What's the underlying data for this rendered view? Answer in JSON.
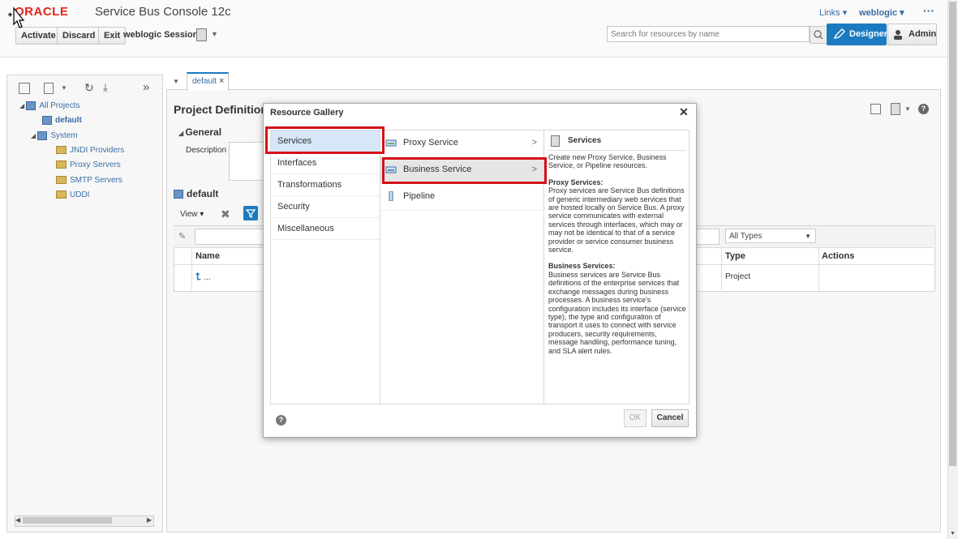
{
  "header": {
    "logo": "ORACLE",
    "product": "Service Bus Console 12c",
    "links_label": "Links",
    "user_label": "weblogic",
    "more_label": "···",
    "activate": "Activate",
    "discard": "Discard",
    "exit": "Exit",
    "session": "weblogic Session",
    "search_placeholder": "Search for resources by name",
    "designer": "Designer",
    "admin": "Admin"
  },
  "tree": {
    "all_projects": "All Projects",
    "default": "default",
    "system": "System",
    "children": [
      "JNDI Providers",
      "Proxy Servers",
      "SMTP Servers",
      "UDDI"
    ]
  },
  "main": {
    "tab": "default",
    "title": "Project Definition",
    "general": "General",
    "description_label": "Description",
    "section": "default",
    "view": "View",
    "filter_value": "All Types",
    "columns": {
      "name": "Name",
      "type": "Type",
      "actions": "Actions"
    },
    "row": {
      "name": "...",
      "type": "Project"
    }
  },
  "dialog": {
    "title": "Resource Gallery",
    "categories": [
      "Services",
      "Interfaces",
      "Transformations",
      "Security",
      "Miscellaneous"
    ],
    "services": [
      "Proxy Service",
      "Business Service",
      "Pipeline"
    ],
    "arrow": ">",
    "desc_title": "Services",
    "desc_intro": "Create new Proxy Service, Business Service, or Pipeline resources.",
    "proxy_heading": "Proxy Services:",
    "proxy_text": "Proxy services are Service Bus definitions of generic intermediary web services that are hosted locally on Service Bus. A proxy service communicates with external services through interfaces, which may or may not be identical to that of a service provider or service consumer business service.",
    "business_heading": "Business Services:",
    "business_text": "Business services are Service Bus definitions of the enterprise services that exchange messages during business processes. A business service's configuration includes its interface (service type), the type and configuration of transport it uses to connect with service producers, security requirements, message handling, performance tuning, and SLA alert rules.",
    "ok": "OK",
    "cancel": "Cancel"
  },
  "colors": {
    "accent": "#1c7bc0",
    "highlight": "#d5101b",
    "logo": "#e0261b"
  }
}
